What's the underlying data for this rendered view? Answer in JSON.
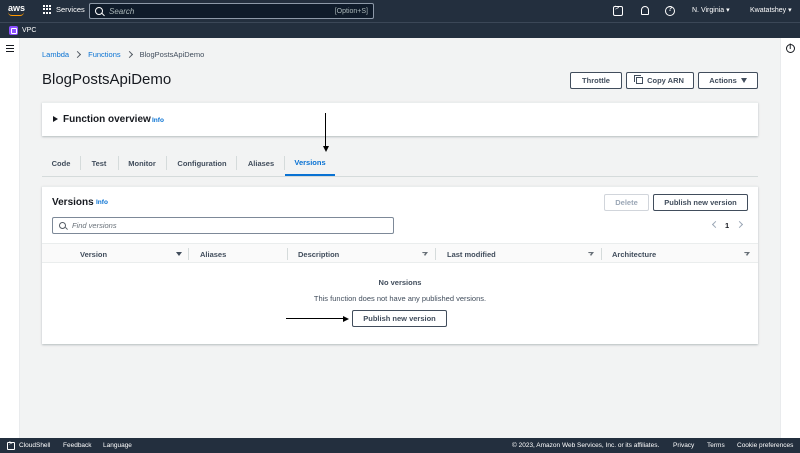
{
  "topnav": {
    "logo": "aws",
    "services_label": "Services",
    "search_placeholder": "Search",
    "search_shortcut": "[Option+S]",
    "region": "N. Virginia",
    "user": "Kwatatshey",
    "icons": [
      "grid-icon",
      "search-icon",
      "cloudshell-icon",
      "bell-icon",
      "help-icon"
    ]
  },
  "favorites": {
    "vpc_label": "VPC"
  },
  "breadcrumb": {
    "items": [
      "Lambda",
      "Functions",
      "BlogPostsApiDemo"
    ]
  },
  "page": {
    "title": "BlogPostsApiDemo",
    "buttons": {
      "throttle": "Throttle",
      "copy_arn": "Copy ARN",
      "actions": "Actions"
    }
  },
  "overview": {
    "title": "Function overview",
    "info": "Info"
  },
  "tabs": [
    "Code",
    "Test",
    "Monitor",
    "Configuration",
    "Aliases",
    "Versions"
  ],
  "active_tab": "Versions",
  "versions": {
    "title": "Versions",
    "info": "Info",
    "delete_label": "Delete",
    "publish_label": "Publish new version",
    "search_placeholder": "Find versions",
    "page_number": "1",
    "columns": [
      "Version",
      "Aliases",
      "Description",
      "Last modified",
      "Architecture"
    ],
    "empty_title": "No versions",
    "empty_desc": "This function does not have any published versions.",
    "empty_publish_label": "Publish new version"
  },
  "footer": {
    "cloudshell": "CloudShell",
    "feedback": "Feedback",
    "language": "Language",
    "copyright": "© 2023, Amazon Web Services, Inc. or its affiliates.",
    "privacy": "Privacy",
    "terms": "Terms",
    "cookies": "Cookie preferences"
  },
  "colors": {
    "nav_bg": "#232f3e",
    "link": "#0972d3",
    "accent": "#ff9900",
    "vpc": "#8c4fff"
  }
}
